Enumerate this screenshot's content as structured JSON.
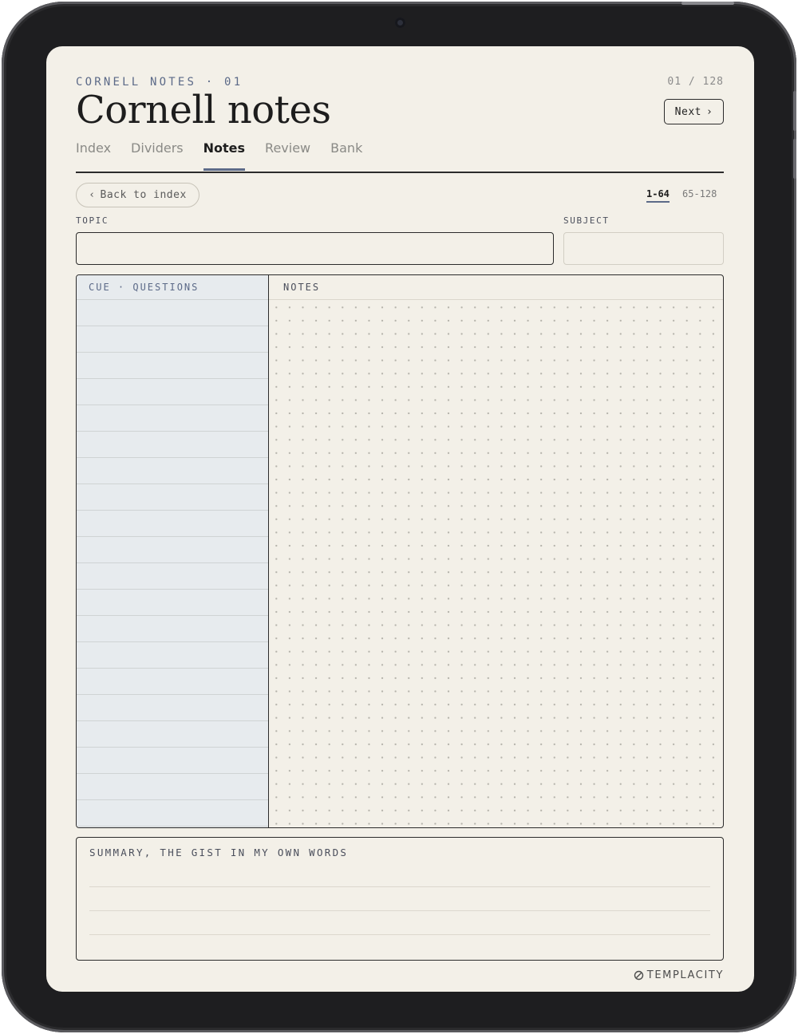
{
  "header": {
    "eyebrow": "CORNELL NOTES · 01",
    "page_counter": "01 / 128",
    "title": "Cornell notes",
    "next_label": "Next",
    "next_chevron": "›"
  },
  "tabs": [
    {
      "label": "Index",
      "active": false
    },
    {
      "label": "Dividers",
      "active": false
    },
    {
      "label": "Notes",
      "active": true
    },
    {
      "label": "Review",
      "active": false
    },
    {
      "label": "Bank",
      "active": false
    }
  ],
  "toolbar": {
    "back_chevron": "‹",
    "back_label": "Back to index",
    "ranges": [
      {
        "label": "1-64",
        "active": true
      },
      {
        "label": "65-128",
        "active": false
      }
    ]
  },
  "fields": {
    "topic_label": "TOPIC",
    "topic_value": "",
    "subject_label": "SUBJECT",
    "subject_value": ""
  },
  "cornell": {
    "cue_header": "CUE · QUESTIONS",
    "notes_header": "NOTES",
    "cue_line_count": 20
  },
  "summary": {
    "label": "SUMMARY, THE GIST IN MY OWN WORDS"
  },
  "brand": {
    "name": "TEMPLACITY",
    "icon": "paperclip-icon"
  },
  "colors": {
    "page": "#f3f0e8",
    "accent": "#5c6a88",
    "cue_panel": "#e7ebee",
    "ink": "#1d1d1d",
    "device": "#1e1e20"
  }
}
